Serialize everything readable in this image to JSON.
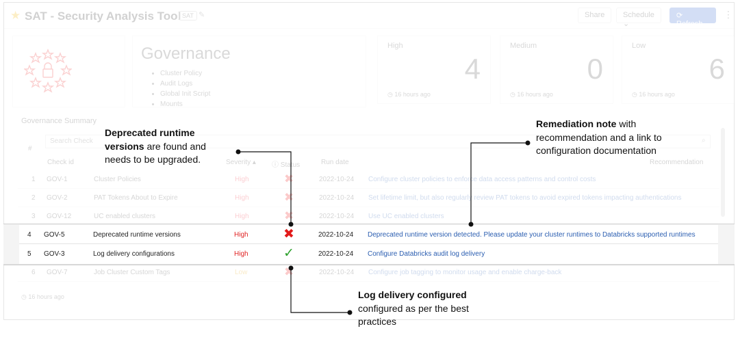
{
  "header": {
    "app_title": "SAT - Security Analysis Tool",
    "tag": "SAT",
    "share_label": "Share",
    "schedule_label": "Schedule",
    "refresh_label": "Refresh"
  },
  "governance": {
    "title": "Governance",
    "items": [
      "Cluster Policy",
      "Audit Logs",
      "Global Init Script",
      "Mounts"
    ]
  },
  "stats": [
    {
      "label": "High",
      "value": "4",
      "time": "16 hours ago"
    },
    {
      "label": "Medium",
      "value": "0",
      "time": "16 hours ago"
    },
    {
      "label": "Low",
      "value": "6",
      "time": "16 hours ago"
    }
  ],
  "summary": {
    "title": "Governance Summary",
    "search_placeholder": "Search Check",
    "footer_time": "16 hours ago",
    "columns": {
      "num": "#",
      "check_id": "Check id",
      "severity": "Severity",
      "status": "Status",
      "run_date": "Run date",
      "recommendation": "Recommendation"
    },
    "rows": [
      {
        "num": "1",
        "check_id": "GOV-1",
        "name": "Cluster Policies",
        "severity": "High",
        "status": "fail",
        "run_date": "2022-10-24",
        "recommendation": "Configure cluster policies to enforce data access patterns and control costs"
      },
      {
        "num": "2",
        "check_id": "GOV-2",
        "name": "PAT Tokens About to Expire",
        "severity": "High",
        "status": "fail",
        "run_date": "2022-10-24",
        "recommendation": "Set lifetime limit, but also regularly review PAT tokens to avoid expired tokens impacting authentications"
      },
      {
        "num": "3",
        "check_id": "GOV-12",
        "name": "UC enabled clusters",
        "severity": "High",
        "status": "fail",
        "run_date": "2022-10-24",
        "recommendation": "Use UC enabled clusters"
      },
      {
        "num": "4",
        "check_id": "GOV-5",
        "name": "Deprecated runtime versions",
        "severity": "High",
        "status": "fail",
        "run_date": "2022-10-24",
        "recommendation": "Deprecated runtime version detected. Please update your cluster runtimes to Databricks supported runtimes"
      },
      {
        "num": "5",
        "check_id": "GOV-3",
        "name": "Log delivery configurations",
        "severity": "High",
        "status": "pass",
        "run_date": "2022-10-24",
        "recommendation": "Configure Databricks audit log delivery"
      },
      {
        "num": "6",
        "check_id": "GOV-7",
        "name": "Job Cluster Custom Tags",
        "severity": "Low",
        "status": "fail",
        "run_date": "2022-10-24",
        "recommendation": "Configure job tagging to monitor usage and enable charge-back"
      }
    ]
  },
  "callouts": {
    "runtime": {
      "bold": "Deprecated runtime versions",
      "rest": " are found and needs to be upgraded."
    },
    "remediation": {
      "bold": "Remediation note",
      "rest": " with recommendation and a link to configuration documentation"
    },
    "log": {
      "bold": "Log delivery configured",
      "rest": "  configured as per the best practices"
    }
  },
  "icons": {
    "fail": "✖",
    "pass": "✓",
    "star": "★"
  },
  "colors": {
    "severity_high": "#e02424",
    "pass_green": "#2ca02c",
    "fail_red": "#e21a1a",
    "link_blue": "#2a5db0",
    "accent_blue": "#3b6fd3"
  }
}
